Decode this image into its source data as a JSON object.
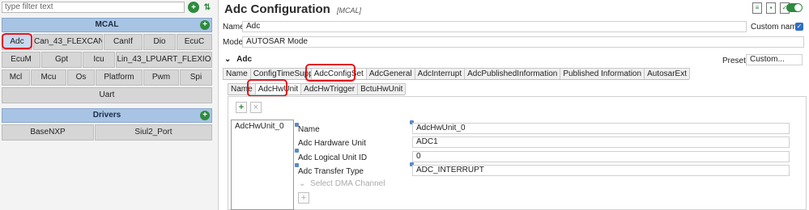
{
  "left": {
    "filter_placeholder": "type filter text",
    "mcal": {
      "header": "MCAL",
      "rows": [
        [
          "Adc",
          "Can_43_FLEXCAN",
          "CanIf",
          "Dio",
          "EcuC"
        ],
        [
          "EcuM",
          "Gpt",
          "Icu",
          "Lin_43_LPUART_FLEXIO"
        ],
        [
          "Mcl",
          "Mcu",
          "Os",
          "Platform",
          "Pwm",
          "Spi"
        ],
        [
          "Uart"
        ]
      ]
    },
    "drivers": {
      "header": "Drivers",
      "rows": [
        [
          "BaseNXP",
          "Siul2_Port"
        ]
      ]
    }
  },
  "right": {
    "title": "Adc Configuration",
    "title_tag": "[MCAL]",
    "name_label": "Name",
    "name_value": "Adc",
    "custom_name_label": "Custom name",
    "mode_label": "Mode",
    "mode_value": "AUTOSAR Mode",
    "section": "Adc",
    "preset_label": "Preset",
    "preset_value": "Custom...",
    "tabs": [
      "Name",
      "ConfigTimeSuppor",
      "AdcConfigSet",
      "AdcGeneral",
      "AdcInterrupt",
      "AdcPublishedInformation",
      "Published Information",
      "AutosarExt"
    ],
    "subtabs": [
      "Name",
      "AdcHwUnit",
      "AdcHwTrigger",
      "BctuHwUnit"
    ],
    "list_item": "AdcHwUnit_0",
    "fields": [
      {
        "label": "Name",
        "value": "AdcHwUnit_0"
      },
      {
        "label": "Adc Hardware Unit",
        "value": "ADC1"
      },
      {
        "label": "Adc Logical Unit ID",
        "value": "0"
      },
      {
        "label": "Adc Transfer Type",
        "value": "ADC_INTERRUPT"
      }
    ],
    "dma_label": "Select DMA Channel"
  },
  "colors": {
    "accent_green": "#2e8b3e",
    "highlight_red": "#e3141b",
    "group_header_blue": "#a8c4e4"
  }
}
